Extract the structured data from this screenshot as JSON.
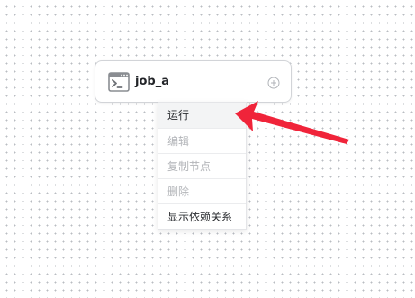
{
  "node": {
    "label": "job_a",
    "icon": "terminal-icon",
    "add_icon": "add-circle-icon"
  },
  "context_menu": {
    "items": [
      {
        "label": "运行",
        "enabled": true
      },
      {
        "label": "编辑",
        "enabled": false
      },
      {
        "label": "复制节点",
        "enabled": false
      },
      {
        "label": "删除",
        "enabled": false
      },
      {
        "label": "显示依赖关系",
        "enabled": true
      }
    ]
  },
  "annotation": {
    "arrow_color": "#f0243a"
  }
}
